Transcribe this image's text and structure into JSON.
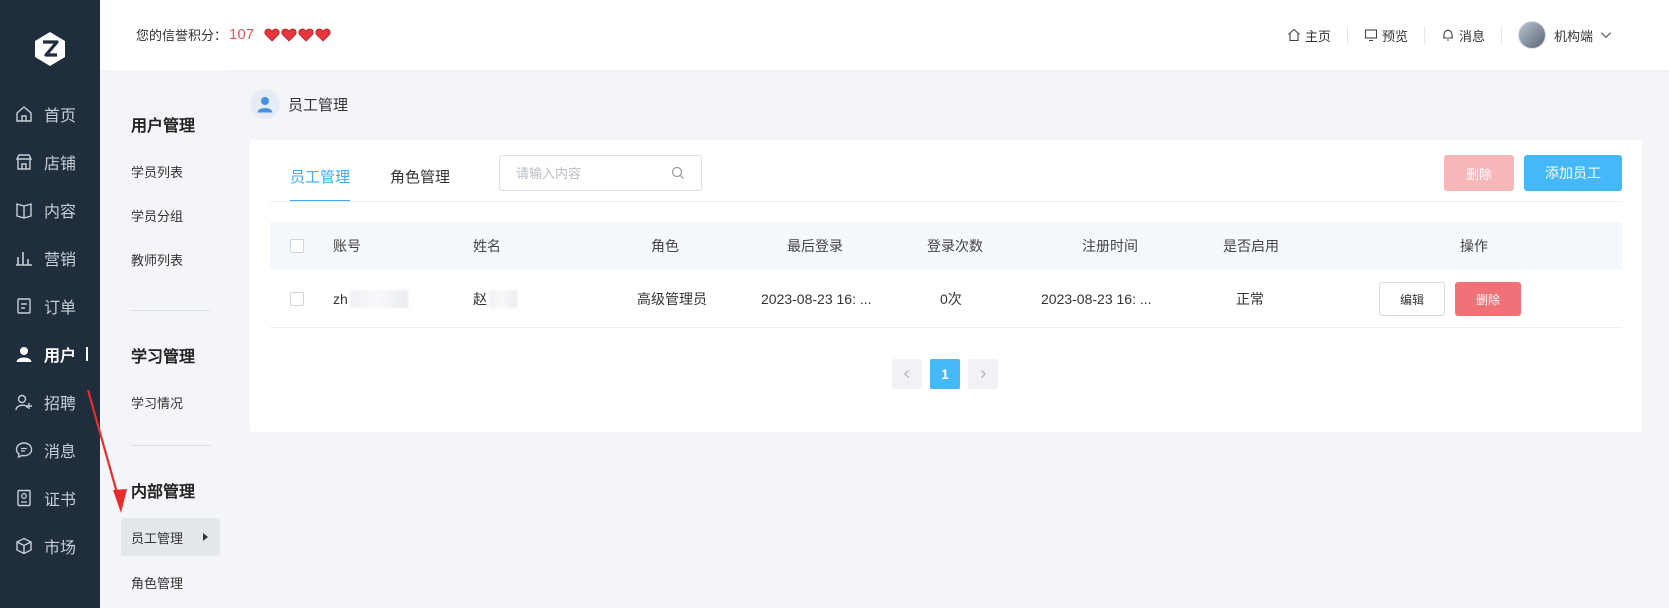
{
  "app": {
    "brand_color": "#1f2d3d",
    "accent": "#3fa9f5",
    "danger": "#f07277"
  },
  "leftnav": {
    "items": [
      {
        "label": "首页",
        "icon": "home-icon"
      },
      {
        "label": "店铺",
        "icon": "store-icon"
      },
      {
        "label": "内容",
        "icon": "book-icon"
      },
      {
        "label": "营销",
        "icon": "chart-icon"
      },
      {
        "label": "订单",
        "icon": "order-icon"
      },
      {
        "label": "用户",
        "icon": "user-icon",
        "active": true
      },
      {
        "label": "招聘",
        "icon": "recruit-icon"
      },
      {
        "label": "消息",
        "icon": "message-icon"
      },
      {
        "label": "证书",
        "icon": "certificate-icon"
      },
      {
        "label": "市场",
        "icon": "market-icon"
      }
    ]
  },
  "header": {
    "credit_label": "您的信誉积分：",
    "credit_score": "107",
    "hearts": 4,
    "links": {
      "home": "主页",
      "preview": "预览",
      "messages": "消息"
    },
    "account_name": "机构端"
  },
  "subnav": {
    "user_group": {
      "title": "用户管理",
      "items": [
        "学员列表",
        "学员分组",
        "教师列表"
      ]
    },
    "learning_group": {
      "title": "学习管理",
      "items": [
        "学习情况"
      ]
    },
    "internal_group": {
      "title": "内部管理",
      "items": [
        "员工管理",
        "角色管理"
      ]
    }
  },
  "breadcrumb": {
    "title": "员工管理"
  },
  "main": {
    "tabs": [
      "员工管理",
      "角色管理"
    ],
    "search_placeholder": "请输入内容",
    "delete_button": "删除",
    "add_button": "添加员工",
    "table": {
      "headers": [
        "账号",
        "姓名",
        "角色",
        "最后登录",
        "登录次数",
        "注册时间",
        "是否启用",
        "操作"
      ],
      "rows": [
        {
          "account": "zh",
          "name": "赵",
          "role": "高级管理员",
          "last_login": "2023-08-23 16: ...",
          "login_count": "0次",
          "registered": "2023-08-23 16: ...",
          "enabled": "正常",
          "edit": "编辑",
          "delete": "删除"
        }
      ]
    },
    "pagination": {
      "current": "1"
    }
  }
}
